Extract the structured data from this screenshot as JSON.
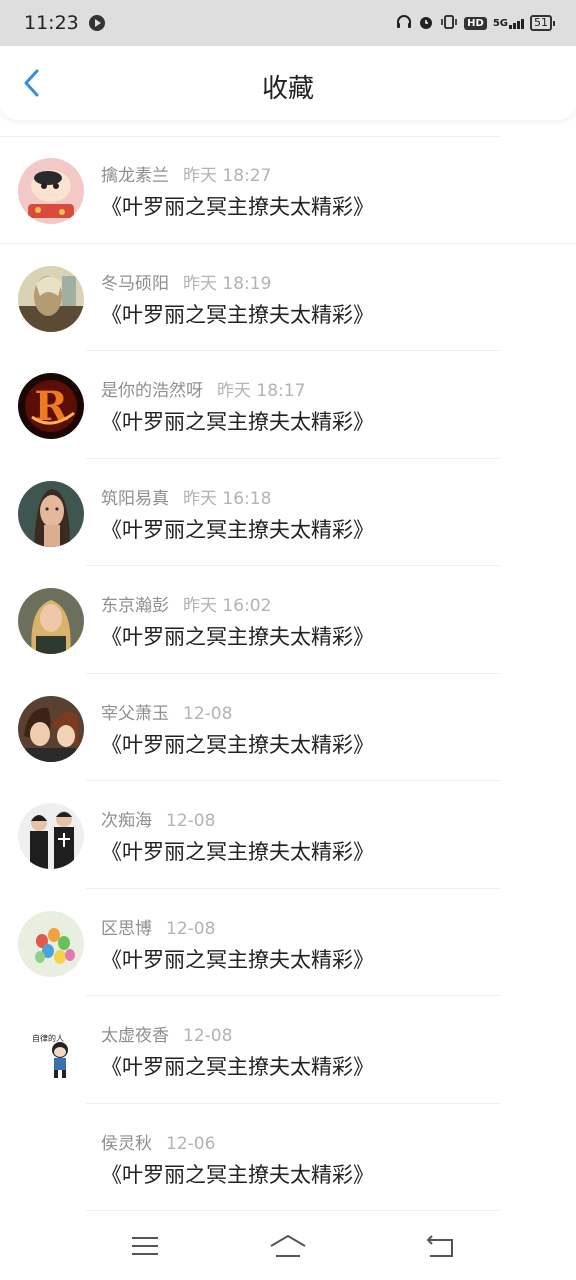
{
  "status": {
    "time": "11:23",
    "battery": "51"
  },
  "header": {
    "title": "收藏"
  },
  "items": [
    {
      "name": "擒龙素兰",
      "time": "昨天 18:27",
      "book": "《叶罗丽之冥主撩夫太精彩》"
    },
    {
      "name": "冬马硕阳",
      "time": "昨天 18:19",
      "book": "《叶罗丽之冥主撩夫太精彩》"
    },
    {
      "name": "是你的浩然呀",
      "time": "昨天 18:17",
      "book": "《叶罗丽之冥主撩夫太精彩》"
    },
    {
      "name": "筑阳易真",
      "time": "昨天 16:18",
      "book": "《叶罗丽之冥主撩夫太精彩》"
    },
    {
      "name": "东京瀚彭",
      "time": "昨天 16:02",
      "book": "《叶罗丽之冥主撩夫太精彩》"
    },
    {
      "name": "宰父萧玉",
      "time": "12-08",
      "book": "《叶罗丽之冥主撩夫太精彩》"
    },
    {
      "name": "次痴海",
      "time": "12-08",
      "book": "《叶罗丽之冥主撩夫太精彩》"
    },
    {
      "name": "区思博",
      "time": "12-08",
      "book": "《叶罗丽之冥主撩夫太精彩》"
    },
    {
      "name": "太虚夜香",
      "time": "12-08",
      "book": "《叶罗丽之冥主撩夫太精彩》"
    },
    {
      "name": "侯灵秋",
      "time": "12-06",
      "book": "《叶罗丽之冥主撩夫太精彩》"
    }
  ],
  "avatar_sticker_text": "自律的人"
}
